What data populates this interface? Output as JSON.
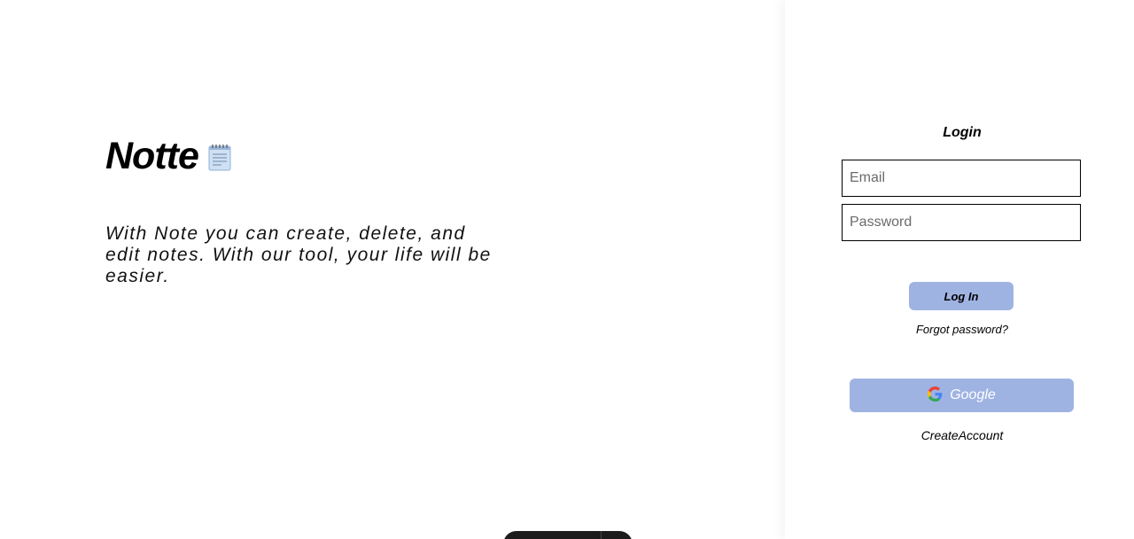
{
  "hero": {
    "title": "Notte",
    "icon": "notepad-icon",
    "tagline": "With Note you can create, delete, and edit notes. With our tool, your life will be easier."
  },
  "auth": {
    "title": "Login",
    "email_placeholder": "Email",
    "password_placeholder": "Password",
    "login_button": "Log In",
    "forgot_password": "Forgot password?",
    "google_button": "Google",
    "create_account": "CreateAccount"
  },
  "colors": {
    "button_bg": "#9fb3e3",
    "page_bg": "#ffffff",
    "toolbar_bg": "#1c1c1c"
  }
}
